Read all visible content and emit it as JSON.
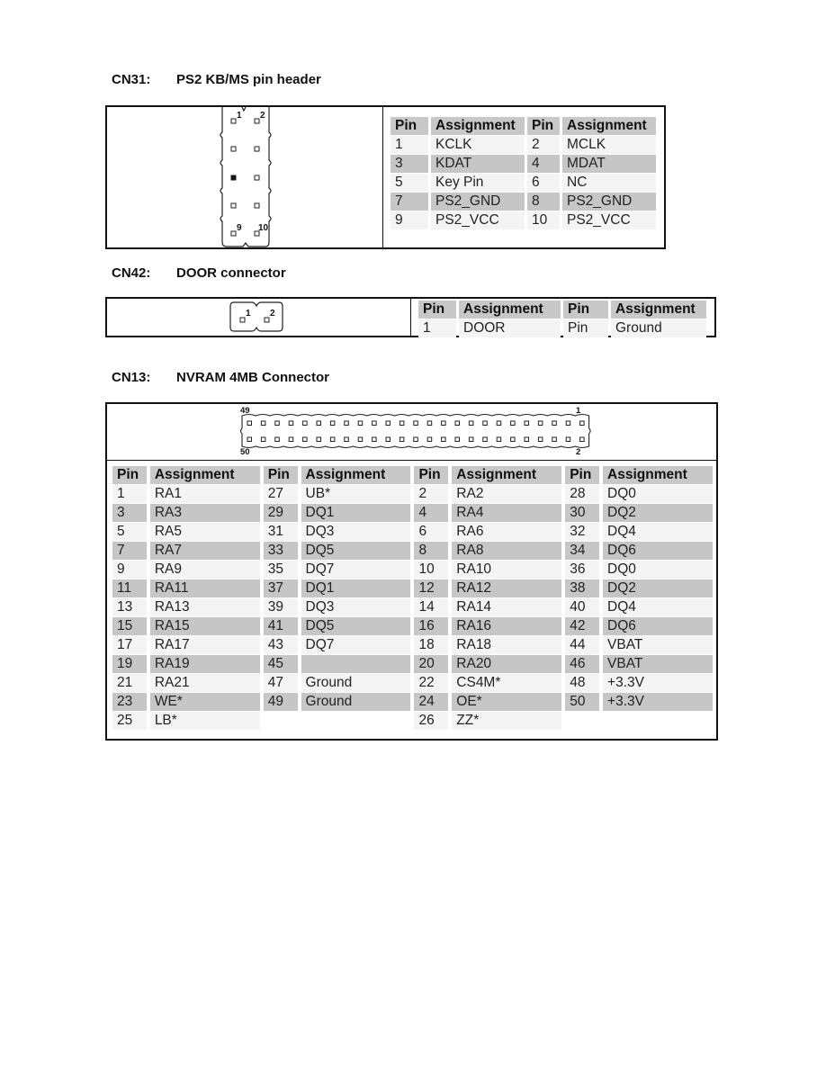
{
  "sections": [
    {
      "id": "cn31",
      "code": "CN31:",
      "title": "PS2 KB/MS pin header",
      "diagram": {
        "type": "2x5 pin header",
        "labels": [
          "1",
          "2",
          "9",
          "10"
        ],
        "filled_pin": 5
      },
      "columns": [
        "Pin",
        "Assignment",
        "Pin",
        "Assignment"
      ],
      "rows": [
        [
          "1",
          "KCLK",
          "2",
          "MCLK"
        ],
        [
          "3",
          "KDAT",
          "4",
          "MDAT"
        ],
        [
          "5",
          "Key Pin",
          "6",
          "NC"
        ],
        [
          "7",
          "PS2_GND",
          "8",
          "PS2_GND"
        ],
        [
          "9",
          "PS2_VCC",
          "10",
          "PS2_VCC"
        ]
      ]
    },
    {
      "id": "cn42",
      "code": "CN42:",
      "title": "DOOR connector",
      "diagram": {
        "type": "1x2 pin header",
        "labels": [
          "1",
          "2"
        ]
      },
      "columns": [
        "Pin",
        "Assignment",
        "Pin",
        "Assignment"
      ],
      "rows": [
        [
          "1",
          "DOOR",
          "Pin",
          "Ground"
        ]
      ]
    },
    {
      "id": "cn13",
      "code": "CN13:",
      "title": "NVRAM 4MB Connector",
      "diagram": {
        "type": "2x25 pin header",
        "labels": [
          "49",
          "1",
          "50",
          "2"
        ]
      },
      "columns": [
        "Pin",
        "Assignment",
        "Pin",
        "Assignment",
        "Pin",
        "Assignment",
        "Pin",
        "Assignment"
      ],
      "rows": [
        [
          "1",
          "RA1",
          "27",
          "UB*",
          "2",
          "RA2",
          "28",
          "DQ0"
        ],
        [
          "3",
          "RA3",
          "29",
          "DQ1",
          "4",
          "RA4",
          "30",
          "DQ2"
        ],
        [
          "5",
          "RA5",
          "31",
          "DQ3",
          "6",
          "RA6",
          "32",
          "DQ4"
        ],
        [
          "7",
          "RA7",
          "33",
          "DQ5",
          "8",
          "RA8",
          "34",
          "DQ6"
        ],
        [
          "9",
          "RA9",
          "35",
          "DQ7",
          "10",
          "RA10",
          "36",
          "DQ0"
        ],
        [
          "11",
          "RA11",
          "37",
          "DQ1",
          "12",
          "RA12",
          "38",
          "DQ2"
        ],
        [
          "13",
          "RA13",
          "39",
          "DQ3",
          "14",
          "RA14",
          "40",
          "DQ4"
        ],
        [
          "15",
          "RA15",
          "41",
          "DQ5",
          "16",
          "RA16",
          "42",
          "DQ6"
        ],
        [
          "17",
          "RA17",
          "43",
          "DQ7",
          "18",
          "RA18",
          "44",
          "VBAT"
        ],
        [
          "19",
          "RA19",
          "45",
          "",
          "20",
          "RA20",
          "46",
          "VBAT"
        ],
        [
          "21",
          "RA21",
          "47",
          "Ground",
          "22",
          "CS4M*",
          "48",
          "+3.3V"
        ],
        [
          "23",
          "WE*",
          "49",
          "Ground",
          "24",
          "OE*",
          "50",
          "+3.3V"
        ],
        [
          "25",
          "LB*",
          "",
          "",
          "26",
          "ZZ*",
          "",
          ""
        ]
      ]
    }
  ]
}
